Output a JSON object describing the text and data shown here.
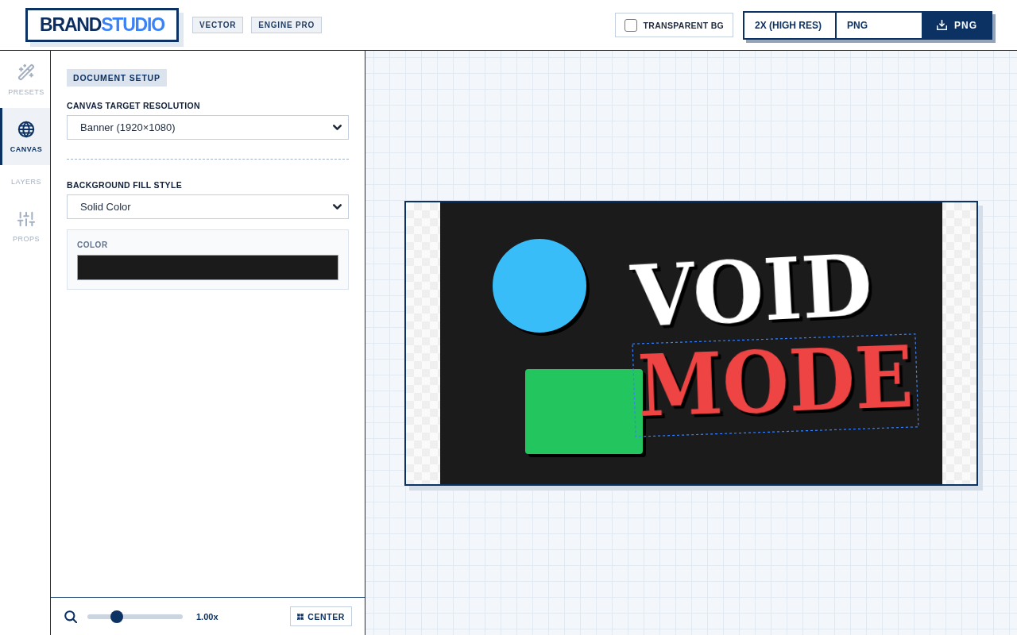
{
  "header": {
    "logo": {
      "primary": "BRAND",
      "accent": "STUDIO"
    },
    "tags": [
      "VECTOR",
      "ENGINE PRO"
    ],
    "transparent_bg": {
      "label": "TRANSPARENT BG",
      "checked": false
    },
    "export": {
      "scale": "2X (HIGH RES)",
      "format": "PNG",
      "button": "PNG"
    }
  },
  "rail": {
    "items": [
      {
        "label": "PRESETS",
        "selected": false
      },
      {
        "label": "CANVAS",
        "selected": true
      },
      {
        "label": "LAYERS",
        "selected": false
      },
      {
        "label": "PROPS",
        "selected": false
      }
    ]
  },
  "panel": {
    "section": "DOCUMENT SETUP",
    "resolution": {
      "label": "CANVAS TARGET RESOLUTION",
      "value": "Banner (1920×1080)"
    },
    "background": {
      "label": "BACKGROUND FILL STYLE",
      "value": "Solid Color",
      "fill": {
        "label": "COLOR",
        "color": "#1b1b1b"
      }
    }
  },
  "zoom": {
    "level": 0.31,
    "reading": "1.00x",
    "center_button": "CENTER"
  },
  "canvas": {
    "layers": [
      {
        "kind": "circle",
        "color": "#38bdf8",
        "selected": false
      },
      {
        "kind": "rect",
        "color": "#22c55e",
        "selected": false
      },
      {
        "kind": "text",
        "text": "VOID",
        "color": "#ffffff",
        "selected": false
      },
      {
        "kind": "text",
        "text": "MODE",
        "color": "#ef4444",
        "selected": true
      }
    ]
  }
}
